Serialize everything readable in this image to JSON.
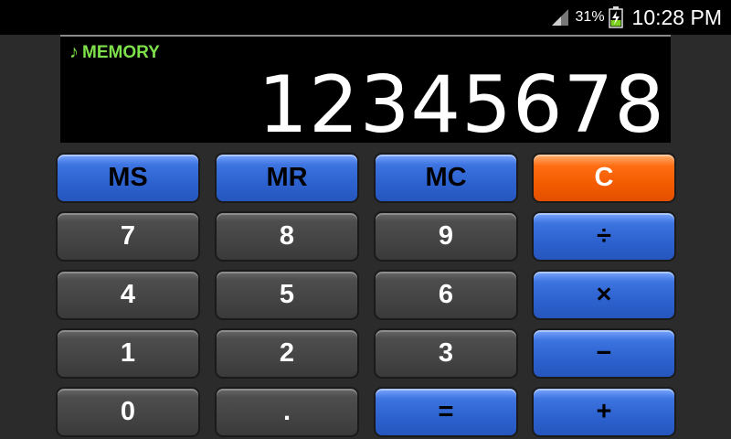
{
  "status_bar": {
    "battery_percent": "31%",
    "time": "10:28 PM",
    "icons": [
      "signal-icon",
      "battery-charging-icon"
    ]
  },
  "display": {
    "memory_label": "MEMORY",
    "memory_icon": "music-note-icon",
    "value": "12345678"
  },
  "keys": {
    "ms": "MS",
    "mr": "MR",
    "mc": "MC",
    "clear": "C",
    "seven": "7",
    "eight": "8",
    "nine": "9",
    "divide": "÷",
    "four": "4",
    "five": "5",
    "six": "6",
    "multiply": "×",
    "one": "1",
    "two": "2",
    "three": "3",
    "subtract": "−",
    "zero": "0",
    "decimal": ".",
    "equals": "=",
    "add": "+"
  },
  "colors": {
    "memory_text": "#7ee04a",
    "number_key": "#4d4d4d",
    "function_key": "#2d62cf",
    "clear_key": "#f35a00",
    "background": "#2b2b2b"
  }
}
